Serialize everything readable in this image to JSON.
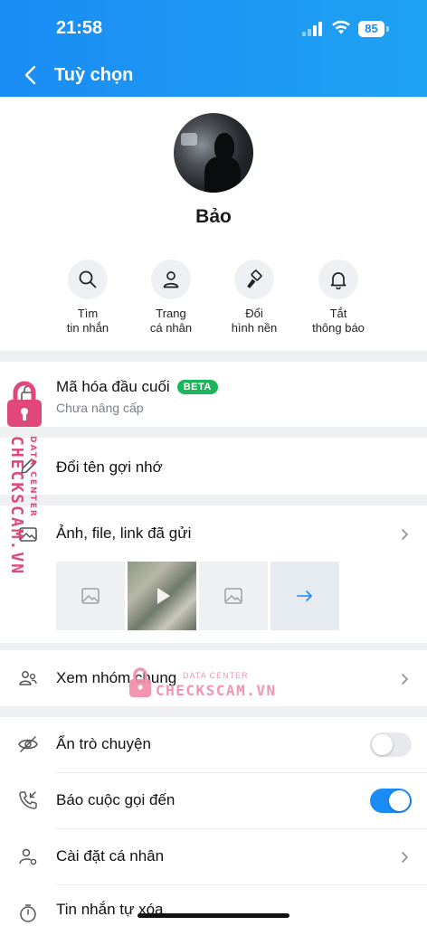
{
  "status_bar": {
    "time": "21:58",
    "battery": "85"
  },
  "nav": {
    "title": "Tuỳ chọn"
  },
  "profile": {
    "name": "Bảo"
  },
  "actions": [
    {
      "line1": "Tìm",
      "line2": "tin nhắn",
      "icon": "search-icon"
    },
    {
      "line1": "Trang",
      "line2": "cá nhân",
      "icon": "user-icon"
    },
    {
      "line1": "Đổi",
      "line2": "hình nền",
      "icon": "paint-brush-icon"
    },
    {
      "line1": "Tắt",
      "line2": "thông báo",
      "icon": "bell-icon"
    }
  ],
  "encryption": {
    "title": "Mã hóa đầu cuối",
    "badge": "BETA",
    "subtitle": "Chưa nâng cấp"
  },
  "rename": {
    "title": "Đổi tên gợi nhớ"
  },
  "media": {
    "title": "Ảnh, file, link đã gửi"
  },
  "groups": {
    "title": "Xem nhóm chung"
  },
  "hide_chat": {
    "title": "Ẩn trò chuyện",
    "enabled": false
  },
  "call_alert": {
    "title": "Báo cuộc gọi đến",
    "enabled": true
  },
  "personal_settings": {
    "title": "Cài đặt cá nhân"
  },
  "auto_delete": {
    "title": "Tin nhắn tự xóa"
  },
  "watermark": {
    "brand": "CHECKSCAM.VN",
    "tag": "DATA CENTER"
  },
  "colors": {
    "accent": "#1a8cf5",
    "beta": "#1bb55c",
    "watermark": "#e0487a"
  }
}
